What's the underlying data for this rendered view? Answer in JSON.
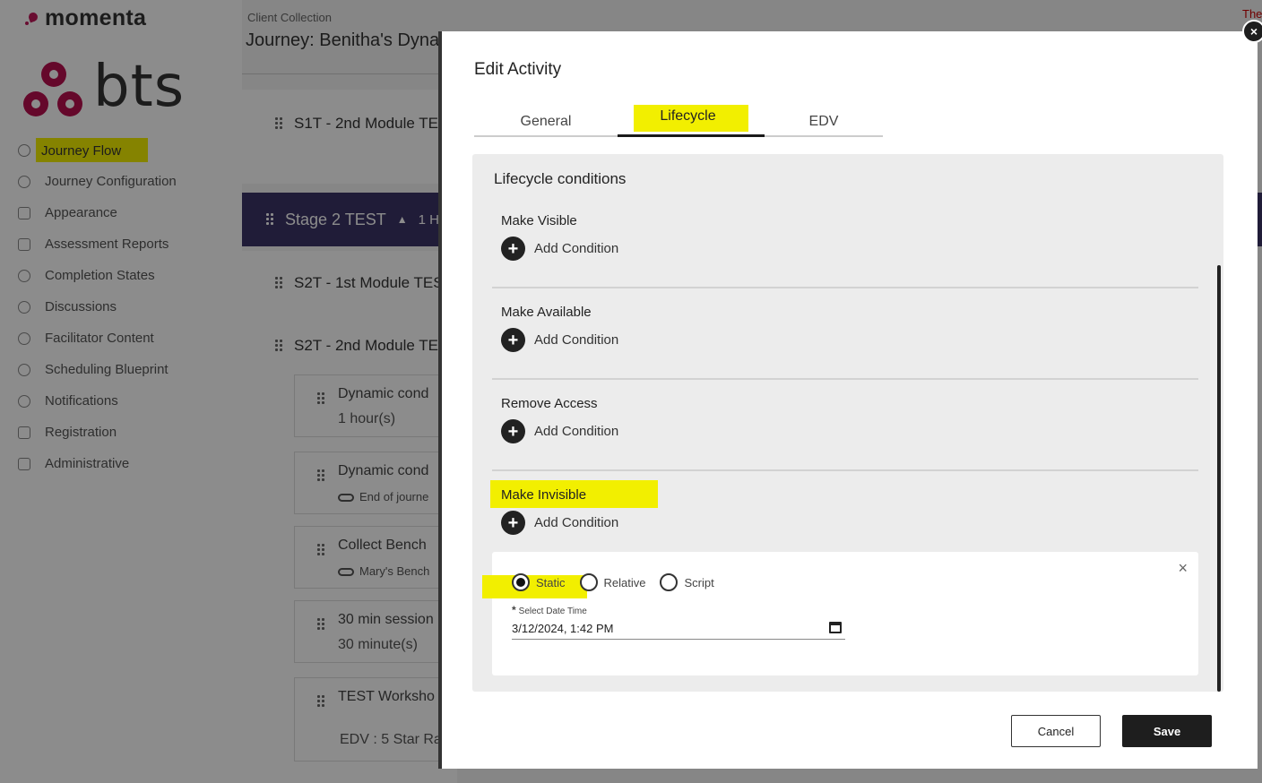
{
  "brand": {
    "name": "momenta",
    "logo_text": "bts"
  },
  "sidebar": {
    "items": [
      {
        "label": "Journey Flow",
        "icon": "map-pin-icon"
      },
      {
        "label": "Journey Configuration",
        "icon": "gear-icon"
      },
      {
        "label": "Appearance",
        "icon": "image-icon"
      },
      {
        "label": "Assessment Reports",
        "icon": "document-icon"
      },
      {
        "label": "Completion States",
        "icon": "check-circle-icon"
      },
      {
        "label": "Discussions",
        "icon": "chat-icon"
      },
      {
        "label": "Facilitator Content",
        "icon": "user-icon"
      },
      {
        "label": "Scheduling Blueprint",
        "icon": "map-pin-icon"
      },
      {
        "label": "Notifications",
        "icon": "bell-icon"
      },
      {
        "label": "Registration",
        "icon": "document-icon"
      },
      {
        "label": "Administrative",
        "icon": "admin-gear-icon"
      }
    ]
  },
  "main": {
    "breadcrumb": "Client Collection",
    "title": "Journey: Benitha's Dyna",
    "right_edge_text": "The",
    "modules": [
      {
        "label": "S1T - 2nd Module TE"
      },
      {
        "label": "S2T - 1st Module TES"
      },
      {
        "label": "S2T - 2nd Module TE"
      }
    ],
    "stage": {
      "label": "Stage 2 TEST",
      "suffix": "1 H"
    },
    "activities": [
      {
        "title": "Dynamic cond",
        "sub": "1 hour(s)"
      },
      {
        "title": "Dynamic cond",
        "sub": "End of journe"
      },
      {
        "title": "Collect Bench",
        "sub": "Mary's Bench"
      },
      {
        "title": "30 min session",
        "sub": "30 minute(s)"
      },
      {
        "title": "TEST Worksho",
        "sub": "EDV : 5 Star Ra"
      }
    ]
  },
  "modal": {
    "title": "Edit Activity",
    "close_label": "×",
    "tabs": [
      {
        "label": "General"
      },
      {
        "label": "Lifecycle"
      },
      {
        "label": "EDV"
      }
    ],
    "panel_title": "Lifecycle conditions",
    "sections": [
      {
        "title": "Make Visible",
        "add_label": "Add Condition"
      },
      {
        "title": "Make Available",
        "add_label": "Add Condition"
      },
      {
        "title": "Remove Access",
        "add_label": "Add Condition"
      },
      {
        "title": "Make Invisible",
        "add_label": "Add Condition"
      }
    ],
    "condition": {
      "close_label": "×",
      "radios": [
        {
          "label": "Static",
          "checked": true
        },
        {
          "label": "Relative",
          "checked": false
        },
        {
          "label": "Script",
          "checked": false
        }
      ],
      "datetime_required_mark": "*",
      "datetime_label": "Select Date Time",
      "datetime_value": "3/12/2024, 1:42 PM"
    },
    "buttons": {
      "cancel": "Cancel",
      "save": "Save"
    }
  },
  "colors": {
    "highlight": "#f2ef00",
    "stage": "#3b3366",
    "brand": "#b8104f",
    "primary_button": "#1e1e1e"
  }
}
